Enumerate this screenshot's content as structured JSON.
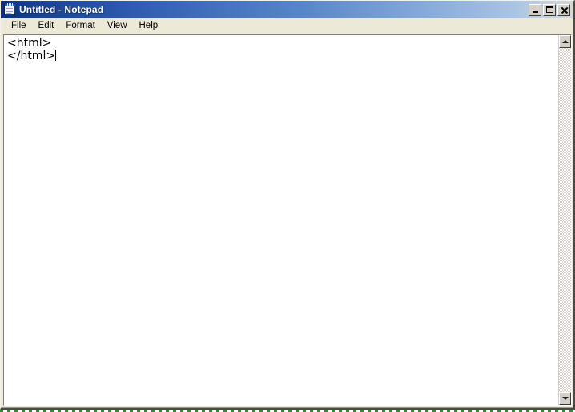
{
  "window": {
    "title": "Untitled - Notepad",
    "icon": "notepad-icon",
    "accent_color": "#0c2f7a",
    "titlebar_end_color": "#a9c3e3",
    "face_color": "#ece9d8",
    "controls": [
      {
        "name": "minimize",
        "label": "_",
        "tooltip": "Minimize"
      },
      {
        "name": "maximize",
        "label": "□",
        "tooltip": "Maximize"
      },
      {
        "name": "close",
        "label": "✕",
        "tooltip": "Close"
      }
    ]
  },
  "menubar": {
    "items": [
      {
        "label": "File"
      },
      {
        "label": "Edit"
      },
      {
        "label": "Format"
      },
      {
        "label": "View"
      },
      {
        "label": "Help"
      }
    ]
  },
  "editor": {
    "name": "text-editor",
    "lines": [
      "<html>",
      "</html>"
    ],
    "caret_line": 1,
    "caret_visible": true,
    "background_color": "#ffffff",
    "text_color": "#000000",
    "word_wrap": false
  },
  "scrollbar": {
    "orientation": "vertical",
    "up_arrow": "▲",
    "down_arrow": "▼",
    "thumb_visible": false,
    "track_style": "dithered"
  },
  "desktop": {
    "strip_color": "#2f7d32",
    "visible": true
  }
}
